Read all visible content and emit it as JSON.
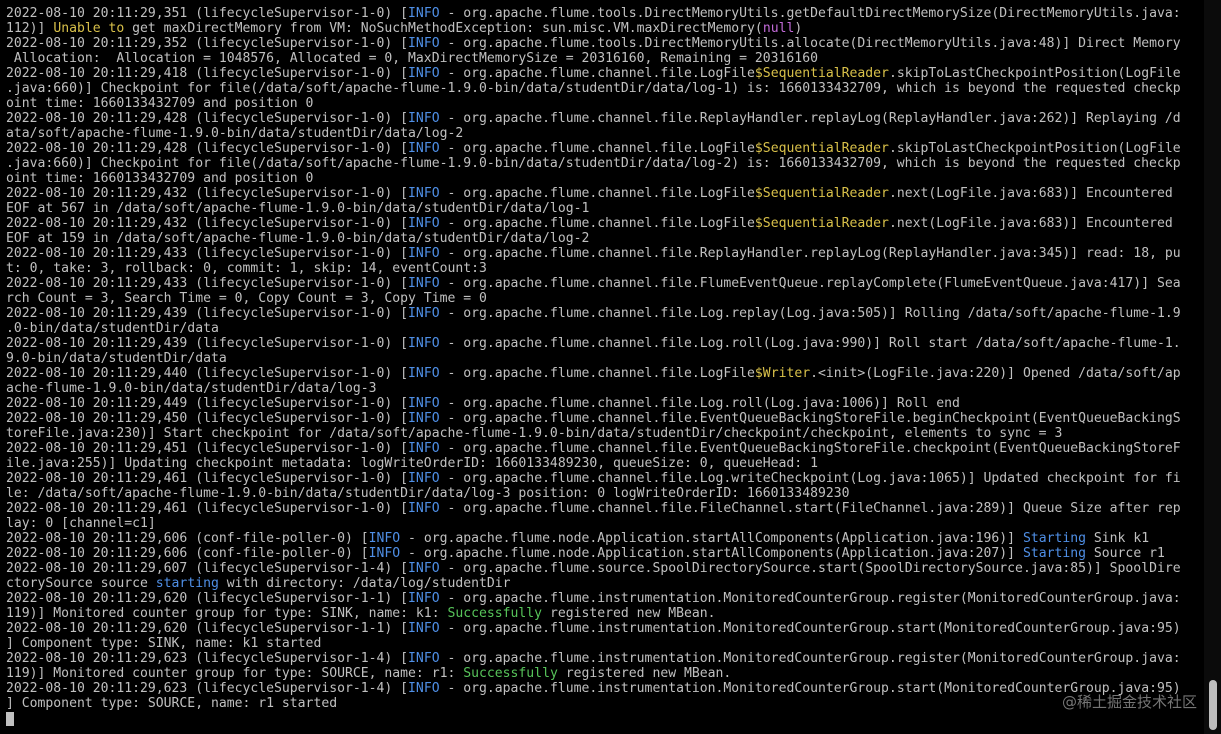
{
  "colors": {
    "background": "#000000",
    "text": "#c0c0c0",
    "info": "#4f8fe6",
    "highlight_yellow": "#d9c14a",
    "highlight_magenta": "#c36bd9",
    "highlight_green": "#57c45a"
  },
  "lines": [
    [
      {
        "t": "2022-08-10 20:11:29,351 (lifecycleSupervisor-1-0) ["
      },
      {
        "t": "INFO",
        "c": "info"
      },
      {
        "t": " - org.apache.flume.tools.DirectMemoryUtils.getDefaultDirectMemorySize(DirectMemoryUtils.java:"
      }
    ],
    [
      {
        "t": "112)] "
      },
      {
        "t": "Unable to",
        "c": "yel"
      },
      {
        "t": " get maxDirectMemory from VM: NoSuchMethodException: sun.misc.VM.maxDirectMemory("
      },
      {
        "t": "null",
        "c": "mag"
      },
      {
        "t": ")"
      }
    ],
    [
      {
        "t": "2022-08-10 20:11:29,352 (lifecycleSupervisor-1-0) ["
      },
      {
        "t": "INFO",
        "c": "info"
      },
      {
        "t": " - org.apache.flume.tools.DirectMemoryUtils.allocate(DirectMemoryUtils.java:48)] Direct Memory"
      }
    ],
    [
      {
        "t": " Allocation:  Allocation = 1048576, Allocated = 0, MaxDirectMemorySize = 20316160, Remaining = 20316160"
      }
    ],
    [
      {
        "t": "2022-08-10 20:11:29,418 (lifecycleSupervisor-1-0) ["
      },
      {
        "t": "INFO",
        "c": "info"
      },
      {
        "t": " - org.apache.flume.channel.file.LogFile"
      },
      {
        "t": "$SequentialReader",
        "c": "yel"
      },
      {
        "t": ".skipToLastCheckpointPosition(LogFile"
      }
    ],
    [
      {
        "t": ".java:660)] Checkpoint for file(/data/soft/apache-flume-1.9.0-bin/data/studentDir/data/log-1) is: 1660133432709, which is beyond the requested checkp"
      }
    ],
    [
      {
        "t": "oint time: 1660133432709 and position 0"
      }
    ],
    [
      {
        "t": "2022-08-10 20:11:29,428 (lifecycleSupervisor-1-0) ["
      },
      {
        "t": "INFO",
        "c": "info"
      },
      {
        "t": " - org.apache.flume.channel.file.ReplayHandler.replayLog(ReplayHandler.java:262)] Replaying /d"
      }
    ],
    [
      {
        "t": "ata/soft/apache-flume-1.9.0-bin/data/studentDir/data/log-2"
      }
    ],
    [
      {
        "t": "2022-08-10 20:11:29,428 (lifecycleSupervisor-1-0) ["
      },
      {
        "t": "INFO",
        "c": "info"
      },
      {
        "t": " - org.apache.flume.channel.file.LogFile"
      },
      {
        "t": "$SequentialReader",
        "c": "yel"
      },
      {
        "t": ".skipToLastCheckpointPosition(LogFile"
      }
    ],
    [
      {
        "t": ".java:660)] Checkpoint for file(/data/soft/apache-flume-1.9.0-bin/data/studentDir/data/log-2) is: 1660133432709, which is beyond the requested checkp"
      }
    ],
    [
      {
        "t": "oint time: 1660133432709 and position 0"
      }
    ],
    [
      {
        "t": "2022-08-10 20:11:29,432 (lifecycleSupervisor-1-0) ["
      },
      {
        "t": "INFO",
        "c": "info"
      },
      {
        "t": " - org.apache.flume.channel.file.LogFile"
      },
      {
        "t": "$SequentialReader",
        "c": "yel"
      },
      {
        "t": ".next(LogFile.java:683)] Encountered"
      }
    ],
    [
      {
        "t": "EOF at 567 in /data/soft/apache-flume-1.9.0-bin/data/studentDir/data/log-1"
      }
    ],
    [
      {
        "t": "2022-08-10 20:11:29,432 (lifecycleSupervisor-1-0) ["
      },
      {
        "t": "INFO",
        "c": "info"
      },
      {
        "t": " - org.apache.flume.channel.file.LogFile"
      },
      {
        "t": "$SequentialReader",
        "c": "yel"
      },
      {
        "t": ".next(LogFile.java:683)] Encountered"
      }
    ],
    [
      {
        "t": "EOF at 159 in /data/soft/apache-flume-1.9.0-bin/data/studentDir/data/log-2"
      }
    ],
    [
      {
        "t": "2022-08-10 20:11:29,433 (lifecycleSupervisor-1-0) ["
      },
      {
        "t": "INFO",
        "c": "info"
      },
      {
        "t": " - org.apache.flume.channel.file.ReplayHandler.replayLog(ReplayHandler.java:345)] read: 18, pu"
      }
    ],
    [
      {
        "t": "t: 0, take: 3, rollback: 0, commit: 1, skip: 14, eventCount:3"
      }
    ],
    [
      {
        "t": "2022-08-10 20:11:29,433 (lifecycleSupervisor-1-0) ["
      },
      {
        "t": "INFO",
        "c": "info"
      },
      {
        "t": " - org.apache.flume.channel.file.FlumeEventQueue.replayComplete(FlumeEventQueue.java:417)] Sea"
      }
    ],
    [
      {
        "t": "rch Count = 3, Search Time = 0, Copy Count = 3, Copy Time = 0"
      }
    ],
    [
      {
        "t": "2022-08-10 20:11:29,439 (lifecycleSupervisor-1-0) ["
      },
      {
        "t": "INFO",
        "c": "info"
      },
      {
        "t": " - org.apache.flume.channel.file.Log.replay(Log.java:505)] Rolling /data/soft/apache-flume-1.9"
      }
    ],
    [
      {
        "t": ".0-bin/data/studentDir/data"
      }
    ],
    [
      {
        "t": "2022-08-10 20:11:29,439 (lifecycleSupervisor-1-0) ["
      },
      {
        "t": "INFO",
        "c": "info"
      },
      {
        "t": " - org.apache.flume.channel.file.Log.roll(Log.java:990)] Roll start /data/soft/apache-flume-1."
      }
    ],
    [
      {
        "t": "9.0-bin/data/studentDir/data"
      }
    ],
    [
      {
        "t": "2022-08-10 20:11:29,440 (lifecycleSupervisor-1-0) ["
      },
      {
        "t": "INFO",
        "c": "info"
      },
      {
        "t": " - org.apache.flume.channel.file.LogFile"
      },
      {
        "t": "$Writer",
        "c": "yel"
      },
      {
        "t": ".<init>(LogFile.java:220)] Opened /data/soft/ap"
      }
    ],
    [
      {
        "t": "ache-flume-1.9.0-bin/data/studentDir/data/log-3"
      }
    ],
    [
      {
        "t": "2022-08-10 20:11:29,449 (lifecycleSupervisor-1-0) ["
      },
      {
        "t": "INFO",
        "c": "info"
      },
      {
        "t": " - org.apache.flume.channel.file.Log.roll(Log.java:1006)] Roll end"
      }
    ],
    [
      {
        "t": "2022-08-10 20:11:29,450 (lifecycleSupervisor-1-0) ["
      },
      {
        "t": "INFO",
        "c": "info"
      },
      {
        "t": " - org.apache.flume.channel.file.EventQueueBackingStoreFile.beginCheckpoint(EventQueueBackingS"
      }
    ],
    [
      {
        "t": "toreFile.java:230)] Start checkpoint for /data/soft/apache-flume-1.9.0-bin/data/studentDir/checkpoint/checkpoint, elements to sync = 3"
      }
    ],
    [
      {
        "t": "2022-08-10 20:11:29,451 (lifecycleSupervisor-1-0) ["
      },
      {
        "t": "INFO",
        "c": "info"
      },
      {
        "t": " - org.apache.flume.channel.file.EventQueueBackingStoreFile.checkpoint(EventQueueBackingStoreF"
      }
    ],
    [
      {
        "t": "ile.java:255)] Updating checkpoint metadata: logWriteOrderID: 1660133489230, queueSize: 0, queueHead: 1"
      }
    ],
    [
      {
        "t": "2022-08-10 20:11:29,461 (lifecycleSupervisor-1-0) ["
      },
      {
        "t": "INFO",
        "c": "info"
      },
      {
        "t": " - org.apache.flume.channel.file.Log.writeCheckpoint(Log.java:1065)] Updated checkpoint for fi"
      }
    ],
    [
      {
        "t": "le: /data/soft/apache-flume-1.9.0-bin/data/studentDir/data/log-3 position: 0 logWriteOrderID: 1660133489230"
      }
    ],
    [
      {
        "t": "2022-08-10 20:11:29,461 (lifecycleSupervisor-1-0) ["
      },
      {
        "t": "INFO",
        "c": "info"
      },
      {
        "t": " - org.apache.flume.channel.file.FileChannel.start(FileChannel.java:289)] Queue Size after rep"
      }
    ],
    [
      {
        "t": "lay: 0 [channel=c1]"
      }
    ],
    [
      {
        "t": "2022-08-10 20:11:29,606 (conf-file-poller-0) ["
      },
      {
        "t": "INFO",
        "c": "info"
      },
      {
        "t": " - org.apache.flume.node.Application.startAllComponents(Application.java:196)] "
      },
      {
        "t": "Starting",
        "c": "info"
      },
      {
        "t": " Sink k1"
      }
    ],
    [
      {
        "t": "2022-08-10 20:11:29,606 (conf-file-poller-0) ["
      },
      {
        "t": "INFO",
        "c": "info"
      },
      {
        "t": " - org.apache.flume.node.Application.startAllComponents(Application.java:207)] "
      },
      {
        "t": "Starting",
        "c": "info"
      },
      {
        "t": " Source r1"
      }
    ],
    [
      {
        "t": "2022-08-10 20:11:29,607 (lifecycleSupervisor-1-4) ["
      },
      {
        "t": "INFO",
        "c": "info"
      },
      {
        "t": " - org.apache.flume.source.SpoolDirectorySource.start(SpoolDirectorySource.java:85)] SpoolDire"
      }
    ],
    [
      {
        "t": "ctorySource source "
      },
      {
        "t": "starting",
        "c": "info"
      },
      {
        "t": " with directory: /data/log/studentDir"
      }
    ],
    [
      {
        "t": "2022-08-10 20:11:29,620 (lifecycleSupervisor-1-1) ["
      },
      {
        "t": "INFO",
        "c": "info"
      },
      {
        "t": " - org.apache.flume.instrumentation.MonitoredCounterGroup.register(MonitoredCounterGroup.java:"
      }
    ],
    [
      {
        "t": "119)] Monitored counter group for type: SINK, name: k1: "
      },
      {
        "t": "Successfully",
        "c": "grn"
      },
      {
        "t": " registered new MBean."
      }
    ],
    [
      {
        "t": "2022-08-10 20:11:29,620 (lifecycleSupervisor-1-1) ["
      },
      {
        "t": "INFO",
        "c": "info"
      },
      {
        "t": " - org.apache.flume.instrumentation.MonitoredCounterGroup.start(MonitoredCounterGroup.java:95)"
      }
    ],
    [
      {
        "t": "] Component type: SINK, name: k1 started"
      }
    ],
    [
      {
        "t": "2022-08-10 20:11:29,623 (lifecycleSupervisor-1-4) ["
      },
      {
        "t": "INFO",
        "c": "info"
      },
      {
        "t": " - org.apache.flume.instrumentation.MonitoredCounterGroup.register(MonitoredCounterGroup.java:"
      }
    ],
    [
      {
        "t": "119)] Monitored counter group for type: SOURCE, name: r1: "
      },
      {
        "t": "Successfully",
        "c": "grn"
      },
      {
        "t": " registered new MBean."
      }
    ],
    [
      {
        "t": "2022-08-10 20:11:29,623 (lifecycleSupervisor-1-4) ["
      },
      {
        "t": "INFO",
        "c": "info"
      },
      {
        "t": " - org.apache.flume.instrumentation.MonitoredCounterGroup.start(MonitoredCounterGroup.java:95)"
      }
    ],
    [
      {
        "t": "] Component type: SOURCE, name: r1 started"
      }
    ]
  ],
  "watermark": "@稀土掘金技术社区"
}
